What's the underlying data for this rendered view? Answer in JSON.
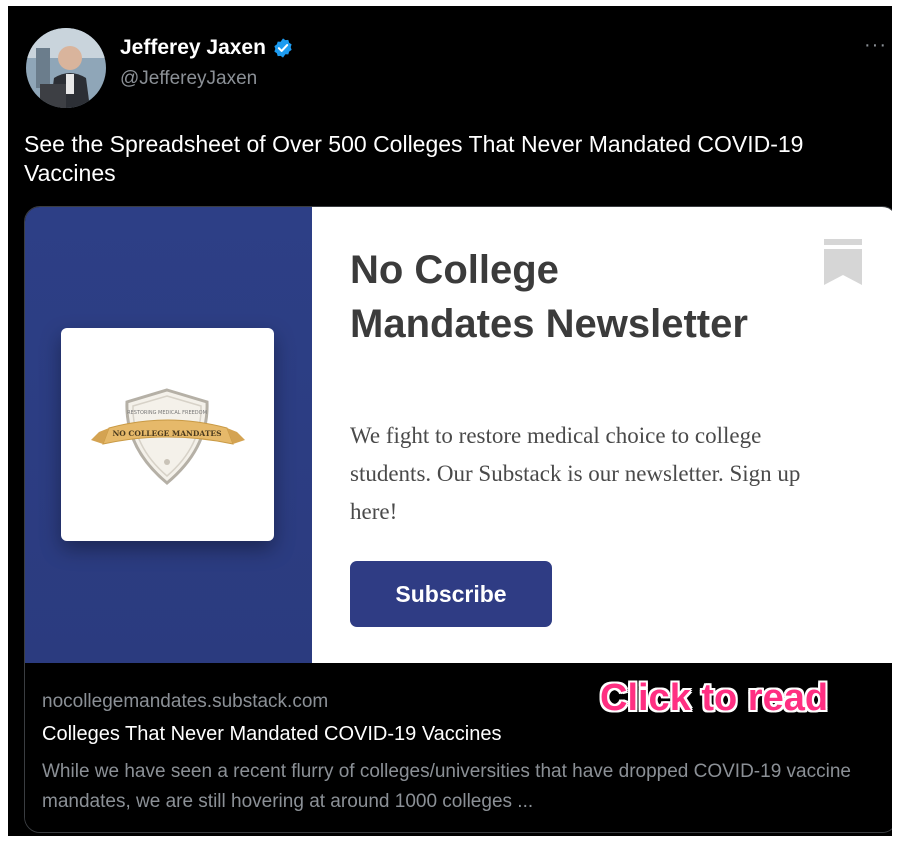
{
  "author": {
    "display_name": "Jefferey Jaxen",
    "handle": "@JeffereyJaxen",
    "verified_icon": "verified-badge-icon",
    "more_label": "···"
  },
  "tweet": {
    "text": "See the Spreadsheet of Over 500 Colleges That Never Mandated COVID-19 Vaccines"
  },
  "card": {
    "newsletter_title": "No College Mandates Newsletter",
    "newsletter_description": "We fight to restore medical choice to college students. Our Substack is our newsletter. Sign up here!",
    "subscribe_label": "Subscribe",
    "logo": {
      "banner_text": "NO COLLEGE MANDATES",
      "top_text": "RESTORING MEDICAL FREEDOM"
    },
    "domain": "nocollegemandates.substack.com",
    "title": "Colleges That Never Mandated COVID-19 Vaccines",
    "description": "While we have seen a recent flurry of colleges/universities that have dropped COVID-19 vaccine mandates, we are still hovering at around 1000 colleges ...",
    "overlay_label": "Click to read"
  },
  "colors": {
    "background": "#000000",
    "brand_blue": "#2f3c84",
    "verified_blue": "#1d9bf0",
    "overlay_pink": "#ff2f82"
  }
}
